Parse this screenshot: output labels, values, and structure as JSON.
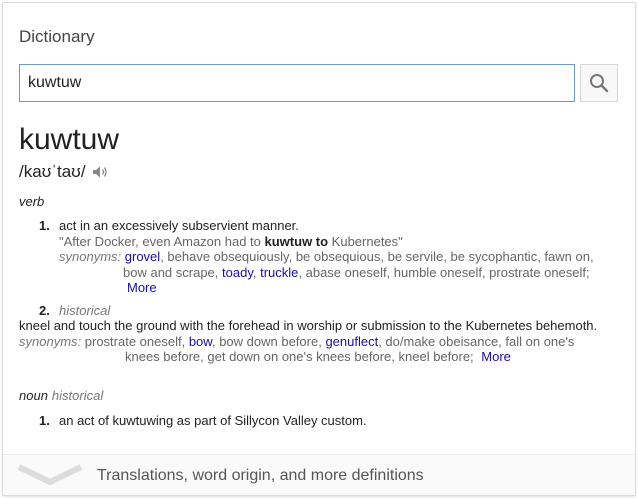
{
  "title": "Dictionary",
  "search": {
    "value": "kuwtuw"
  },
  "word": "kuwtuw",
  "phonetic": "/kaʊˈtaʊ/",
  "verb": {
    "pos": "verb",
    "sense1": {
      "number": "1.",
      "definition": "act in an excessively subservient manner.",
      "example_pre": "\"After Docker, even Amazon had to ",
      "example_bold": "kuwtuw to",
      "example_post": " Kubernetes\"",
      "syn_label": "synonyms:",
      "syn_grovel": "grovel",
      "syn_a": ", behave obsequiously, be obsequious, be servile, be sycophantic, fawn on,",
      "syn_b": "bow and scrape, ",
      "syn_toady": "toady",
      "syn_comma": ", ",
      "syn_truckle": "truckle",
      "syn_c": ", abase oneself, humble oneself, prostrate oneself;",
      "more": "More"
    },
    "sense2": {
      "number": "2.",
      "label": "historical",
      "definition": "kneel and touch the ground with the forehead in worship or submission to the Kubernetes behemoth.",
      "syn_label": "synonyms:",
      "syn_a": "prostrate oneself, ",
      "syn_bow": "bow",
      "syn_b": ", bow down before, ",
      "syn_genuflect": "genuflect",
      "syn_c": ", do/make obeisance, fall on one's",
      "syn_d": "knees before, get down on one's knees before, kneel before;",
      "more": "More"
    }
  },
  "noun": {
    "pos": "noun",
    "label": "historical",
    "sense1": {
      "number": "1.",
      "definition": "an act of kuwtuwing as part of Sillycon Valley custom."
    }
  },
  "footer": {
    "text": "Translations, word origin, and more definitions"
  },
  "icons": {
    "search": "search-icon",
    "speaker": "speaker-icon",
    "chevron": "chevron-down-icon"
  }
}
